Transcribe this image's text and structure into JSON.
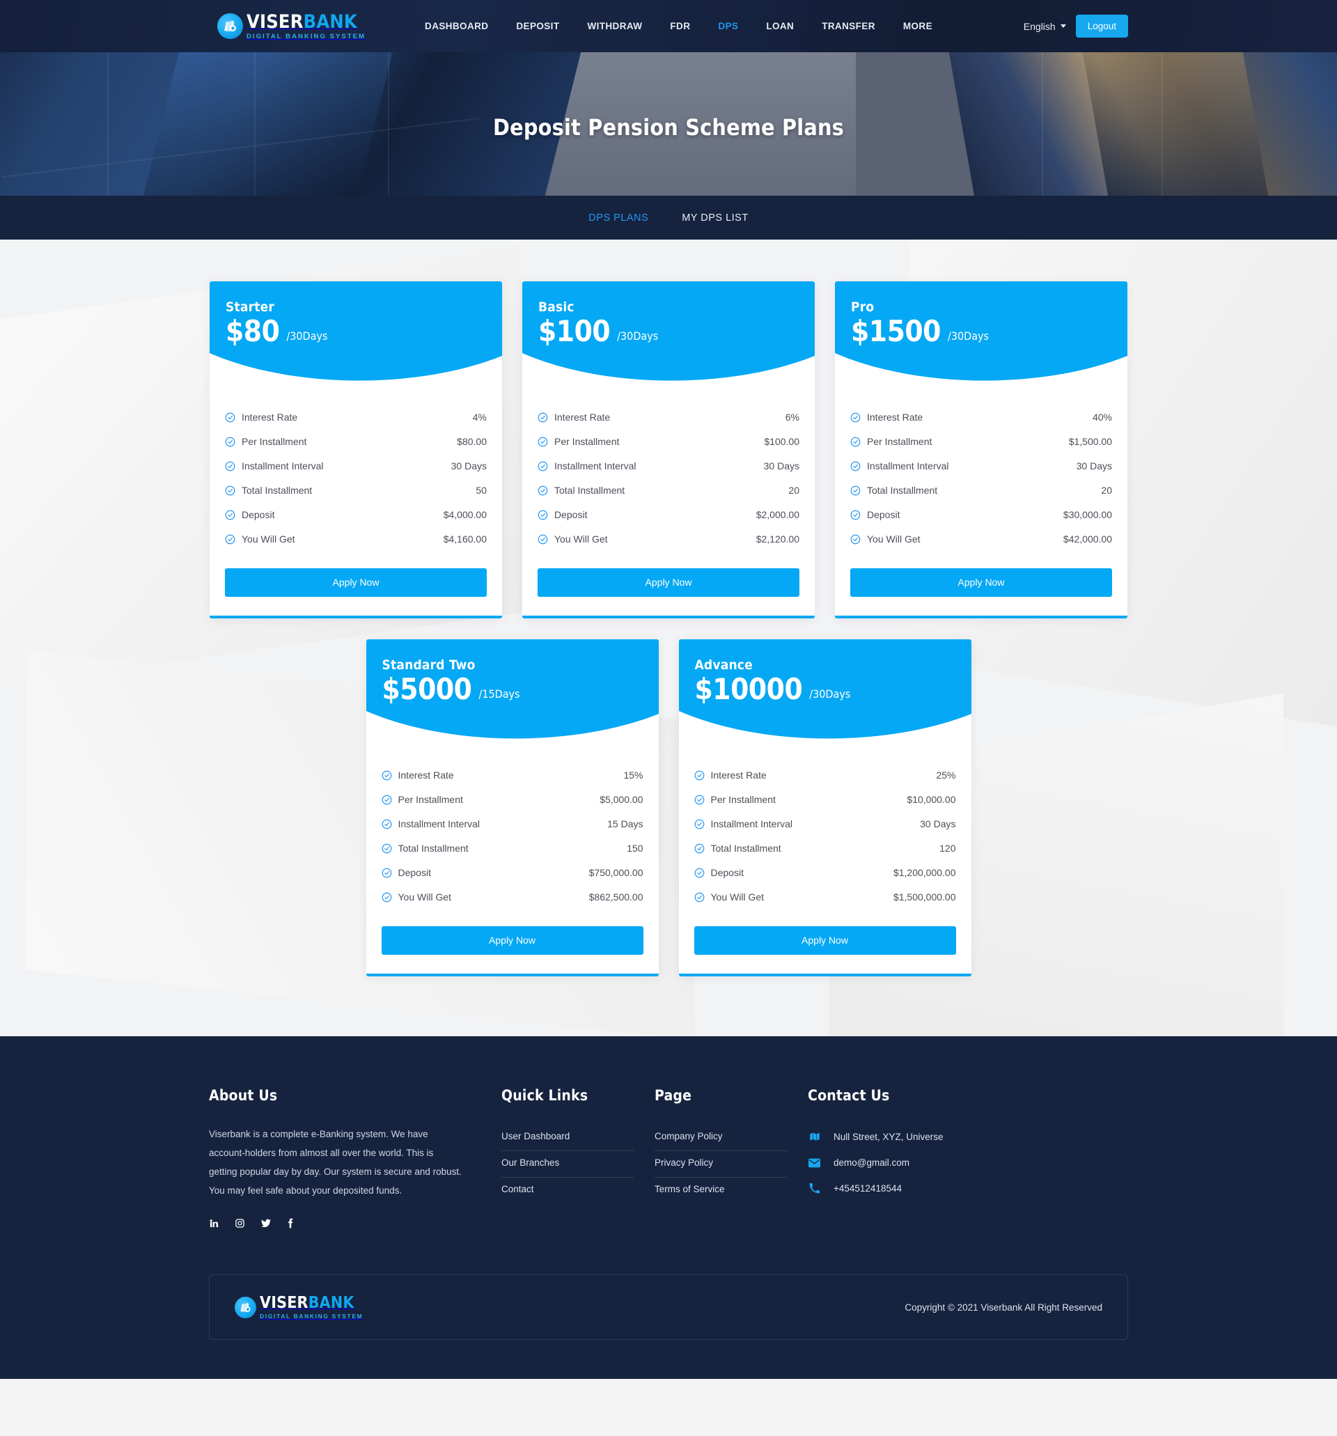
{
  "brand": {
    "name_part1": "VISER",
    "name_part2": "BANK",
    "tagline": "DIGITAL BANKING SYSTEM",
    "accent": "#05a8f4",
    "dark": "#16233f"
  },
  "topnav": {
    "links": [
      {
        "label": "DASHBOARD",
        "active": false
      },
      {
        "label": "DEPOSIT",
        "active": false
      },
      {
        "label": "WITHDRAW",
        "active": false
      },
      {
        "label": "FDR",
        "active": false
      },
      {
        "label": "DPS",
        "active": true
      },
      {
        "label": "LOAN",
        "active": false
      },
      {
        "label": "TRANSFER",
        "active": false
      },
      {
        "label": "MORE",
        "active": false
      }
    ],
    "language": "English",
    "logout_label": "Logout"
  },
  "hero": {
    "title": "Deposit Pension Scheme Plans"
  },
  "tabs": [
    {
      "label": "DPS PLANS",
      "active": true
    },
    {
      "label": "MY DPS LIST",
      "active": false
    }
  ],
  "feature_labels": {
    "interest_rate": "Interest Rate",
    "per_installment": "Per Installment",
    "installment_interval": "Installment Interval",
    "total_installment": "Total Installment",
    "deposit": "Deposit",
    "you_will_get": "You Will Get"
  },
  "apply_label": "Apply Now",
  "plans": [
    {
      "name": "Starter",
      "price": "$80",
      "period": "/30Days",
      "interest_rate": "4%",
      "per_installment": "$80.00",
      "installment_interval": "30 Days",
      "total_installment": "50",
      "deposit": "$4,000.00",
      "you_will_get": "$4,160.00"
    },
    {
      "name": "Basic",
      "price": "$100",
      "period": "/30Days",
      "interest_rate": "6%",
      "per_installment": "$100.00",
      "installment_interval": "30 Days",
      "total_installment": "20",
      "deposit": "$2,000.00",
      "you_will_get": "$2,120.00"
    },
    {
      "name": "Pro",
      "price": "$1500",
      "period": "/30Days",
      "interest_rate": "40%",
      "per_installment": "$1,500.00",
      "installment_interval": "30 Days",
      "total_installment": "20",
      "deposit": "$30,000.00",
      "you_will_get": "$42,000.00"
    },
    {
      "name": "Standard Two",
      "price": "$5000",
      "period": "/15Days",
      "interest_rate": "15%",
      "per_installment": "$5,000.00",
      "installment_interval": "15 Days",
      "total_installment": "150",
      "deposit": "$750,000.00",
      "you_will_get": "$862,500.00"
    },
    {
      "name": "Advance",
      "price": "$10000",
      "period": "/30Days",
      "interest_rate": "25%",
      "per_installment": "$10,000.00",
      "installment_interval": "30 Days",
      "total_installment": "120",
      "deposit": "$1,200,000.00",
      "you_will_get": "$1,500,000.00"
    }
  ],
  "footer": {
    "about": {
      "title": "About Us",
      "text": "Viserbank is a complete e-Banking system. We have account-holders from almost all over the world. This is getting popular day by day. Our system is secure and robust. You may feel safe about your deposited funds.",
      "socials": [
        "linkedin-icon",
        "instagram-icon",
        "twitter-icon",
        "facebook-icon"
      ]
    },
    "quick_links": {
      "title": "Quick Links",
      "items": [
        "User Dashboard",
        "Our Branches",
        "Contact"
      ]
    },
    "page": {
      "title": "Page",
      "items": [
        "Company Policy",
        "Privacy Policy",
        "Terms of Service"
      ]
    },
    "contact": {
      "title": "Contact Us",
      "address": "Null Street, XYZ, Universe",
      "email": "demo@gmail.com",
      "phone": "+454512418544"
    },
    "copyright": "Copyright © 2021 Viserbank All Right Reserved"
  }
}
